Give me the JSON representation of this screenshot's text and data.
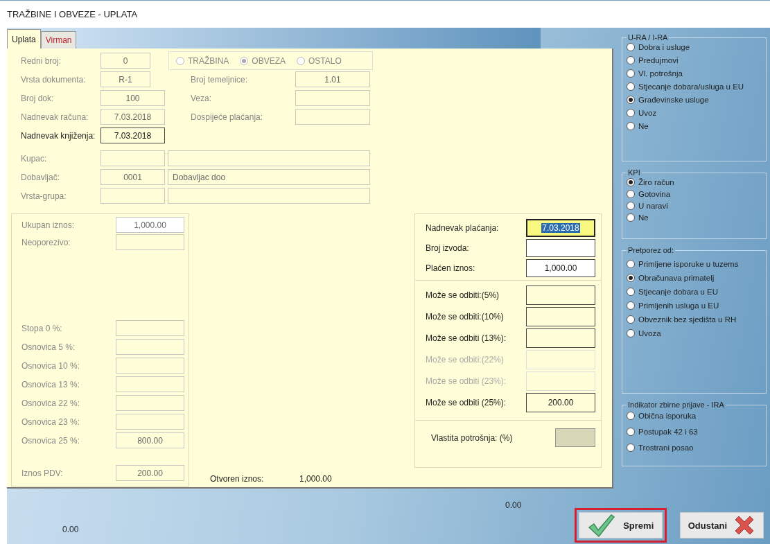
{
  "window": {
    "title": "TRAŽBINE I OBVEZE - UPLATA"
  },
  "tabs": [
    {
      "label": "Uplata",
      "selected": true
    },
    {
      "label": "Virman",
      "selected": false
    }
  ],
  "document_type": {
    "disabled": true,
    "options": [
      {
        "label": "TRAŽBINA",
        "selected": false
      },
      {
        "label": "OBVEZA",
        "selected": true
      },
      {
        "label": "OSTALO",
        "selected": false
      }
    ]
  },
  "document_fields": [
    {
      "label": "Redni broj:",
      "value": "0",
      "disabled": true
    },
    {
      "label": "Vrsta dokumenta:",
      "value": "R-1",
      "disabled": true
    },
    {
      "label": "Broj dok:",
      "value": "100",
      "disabled": true
    },
    {
      "label": "Nadnevak računa:",
      "value": "7.03.2018",
      "disabled": true
    },
    {
      "label": "Nadnevak knjiženja:",
      "value": "7.03.2018",
      "disabled": false
    }
  ],
  "ledger_fields": [
    {
      "label": "Broj temeljnice:",
      "value": "1.01",
      "disabled": true
    },
    {
      "label": "Veza:",
      "disabled": true
    },
    {
      "label": "Dospijeće plaćanja:",
      "disabled": true
    }
  ],
  "partners": [
    {
      "label": "Kupac:",
      "disabled": true
    },
    {
      "label": "Dobavljač:",
      "code": "0001",
      "name": "Dobavljac doo",
      "disabled": true
    },
    {
      "label": "Vrsta-grupa:",
      "disabled": true
    }
  ],
  "totals": [
    {
      "label": "Ukupan iznos:",
      "value": "1,000.00",
      "disabled": true
    },
    {
      "label": "Neoporezivo:",
      "disabled": true
    }
  ],
  "bases": [
    {
      "label": "Stopa 0 %:",
      "disabled": true
    },
    {
      "label": "Osnovica 5 %:",
      "disabled": true
    },
    {
      "label": "Osnovica 10 %:",
      "disabled": true
    },
    {
      "label": "Osnovica 13 %:",
      "disabled": true
    },
    {
      "label": "Osnovica 22 %:",
      "disabled": true
    },
    {
      "label": "Osnovica 23 %:",
      "disabled": true
    },
    {
      "label": "Osnovica 25 %:",
      "value": "800.00",
      "disabled": true
    }
  ],
  "vat": {
    "label": "Iznos PDV:",
    "value": "200.00",
    "disabled": true
  },
  "open_amount": {
    "label": "Otvoren iznos:",
    "value": "1,000.00"
  },
  "payment": [
    {
      "label": "Nadnevak plaćanja:",
      "value": "7.03.2018",
      "focused": true
    },
    {
      "label": "Broj izvoda:",
      "focused": false
    },
    {
      "label": "Plaćen iznos:",
      "value": "1,000.00",
      "focused": false
    }
  ],
  "deductions": [
    {
      "label": "Može se odbiti:(5%)",
      "disabled": false
    },
    {
      "label": "Može se odbiti:(10%)",
      "disabled": false
    },
    {
      "label": "Može se odbiti (13%):",
      "disabled": false
    },
    {
      "label": "Može se odbiti:(22%)",
      "disabled": true
    },
    {
      "label": "Može se odbiti (23%):",
      "disabled": true
    },
    {
      "label": "Može se odbiti (25%):",
      "value": "200.00",
      "disabled": false
    }
  ],
  "own_consumption": {
    "label": "Vlastita potrošnja: (%)",
    "disabled": true
  },
  "groups": [
    {
      "title": "U-RA / I-RA",
      "options": [
        {
          "label": "Dobra i usluge",
          "selected": false
        },
        {
          "label": "Predujmovi",
          "selected": false
        },
        {
          "label": "Vl. potrošnja",
          "selected": false
        },
        {
          "label": "Stjecanje dobara/usluga u EU",
          "selected": false
        },
        {
          "label": "Građevinske usluge",
          "selected": true
        },
        {
          "label": "Uvoz",
          "selected": false
        },
        {
          "label": "Ne",
          "selected": false
        }
      ]
    },
    {
      "title": "KPI",
      "options": [
        {
          "label": "Žiro račun",
          "selected": true
        },
        {
          "label": "Gotovina",
          "selected": false
        },
        {
          "label": "U naravi",
          "selected": false
        },
        {
          "label": "Ne",
          "selected": false
        }
      ]
    },
    {
      "title": "Pretporez od:",
      "options": [
        {
          "label": "Primljene isporuke u tuzems",
          "selected": false
        },
        {
          "label": "Obračunava primatelj",
          "selected": true
        },
        {
          "label": "Stjecanje dobara u EU",
          "selected": false
        },
        {
          "label": "Primljenih usluga u EU",
          "selected": false
        },
        {
          "label": "Obveznik bez sjedišta u RH",
          "selected": false
        },
        {
          "label": "Uvoza",
          "selected": false
        }
      ]
    },
    {
      "title": "Indikator zbirne prijave - IRA",
      "options": [
        {
          "label": "Obična isporuka",
          "selected": false
        },
        {
          "label": "Postupak 42 i 63",
          "selected": false
        },
        {
          "label": "Trostrani posao",
          "selected": false
        }
      ]
    }
  ],
  "footer": {
    "left_value": "0.00",
    "middle_value": "0.00"
  },
  "buttons": [
    {
      "label": "Spremi",
      "kind": "save",
      "highlighted": true
    },
    {
      "label": "Odustani",
      "kind": "cancel",
      "highlighted": false
    }
  ]
}
